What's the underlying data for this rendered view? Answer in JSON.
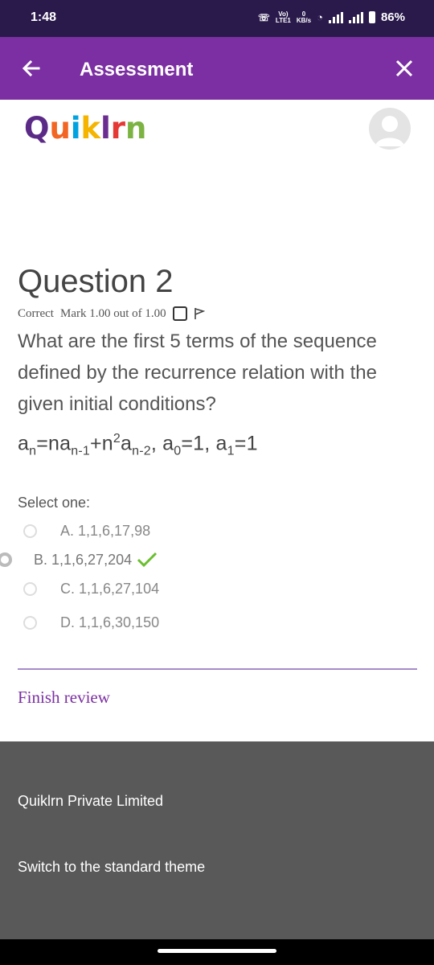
{
  "status_bar": {
    "time": "1:48",
    "network_label_top": "Vo)",
    "network_label_bottom": "LTE1",
    "speed_top": "0",
    "speed_bottom": "KB/s",
    "battery_percent": "86%"
  },
  "app_bar": {
    "title": "Assessment"
  },
  "brand": {
    "letters": [
      "Q",
      "u",
      "i",
      "k",
      "l",
      "r",
      "n"
    ],
    "colors": [
      "#5b2a86",
      "#f26522",
      "#00a3e0",
      "#f4b400",
      "#6c2d91",
      "#e53935",
      "#7cb342"
    ]
  },
  "question": {
    "title": "Question 2",
    "status": "Correct",
    "mark": "Mark 1.00 out of 1.00",
    "text": "What are the first 5 terms of the sequence defined by the recurrence relation with the given initial conditions?",
    "formula": {
      "a1": "a",
      "s1": "n",
      "eq1": "=na",
      "s2": "n-1",
      "plus": "+n",
      "p2": "2",
      "a3": "a",
      "s3": "n-2",
      "comma1": ", a",
      "s4": "0",
      "eq2": "=1, a",
      "s5": "1",
      "eq3": "=1"
    },
    "select_label": "Select one:",
    "options": [
      {
        "label": "A. 1,1,6,17,98"
      },
      {
        "label": "B. 1,1,6,27,204"
      },
      {
        "label": "C. 1,1,6,27,104"
      },
      {
        "label": "D. 1,1,6,30,150"
      }
    ],
    "selected_option": "B",
    "finish_review": "Finish review"
  },
  "footer": {
    "company": "Quiklrn Private Limited",
    "switch_theme": "Switch to the standard theme"
  },
  "colors": {
    "status_bar": "#2a1a4c",
    "app_bar": "#7b2fa2",
    "accent_link": "#7b2fa2",
    "check": "#6bbf2f",
    "footer": "#595959"
  }
}
